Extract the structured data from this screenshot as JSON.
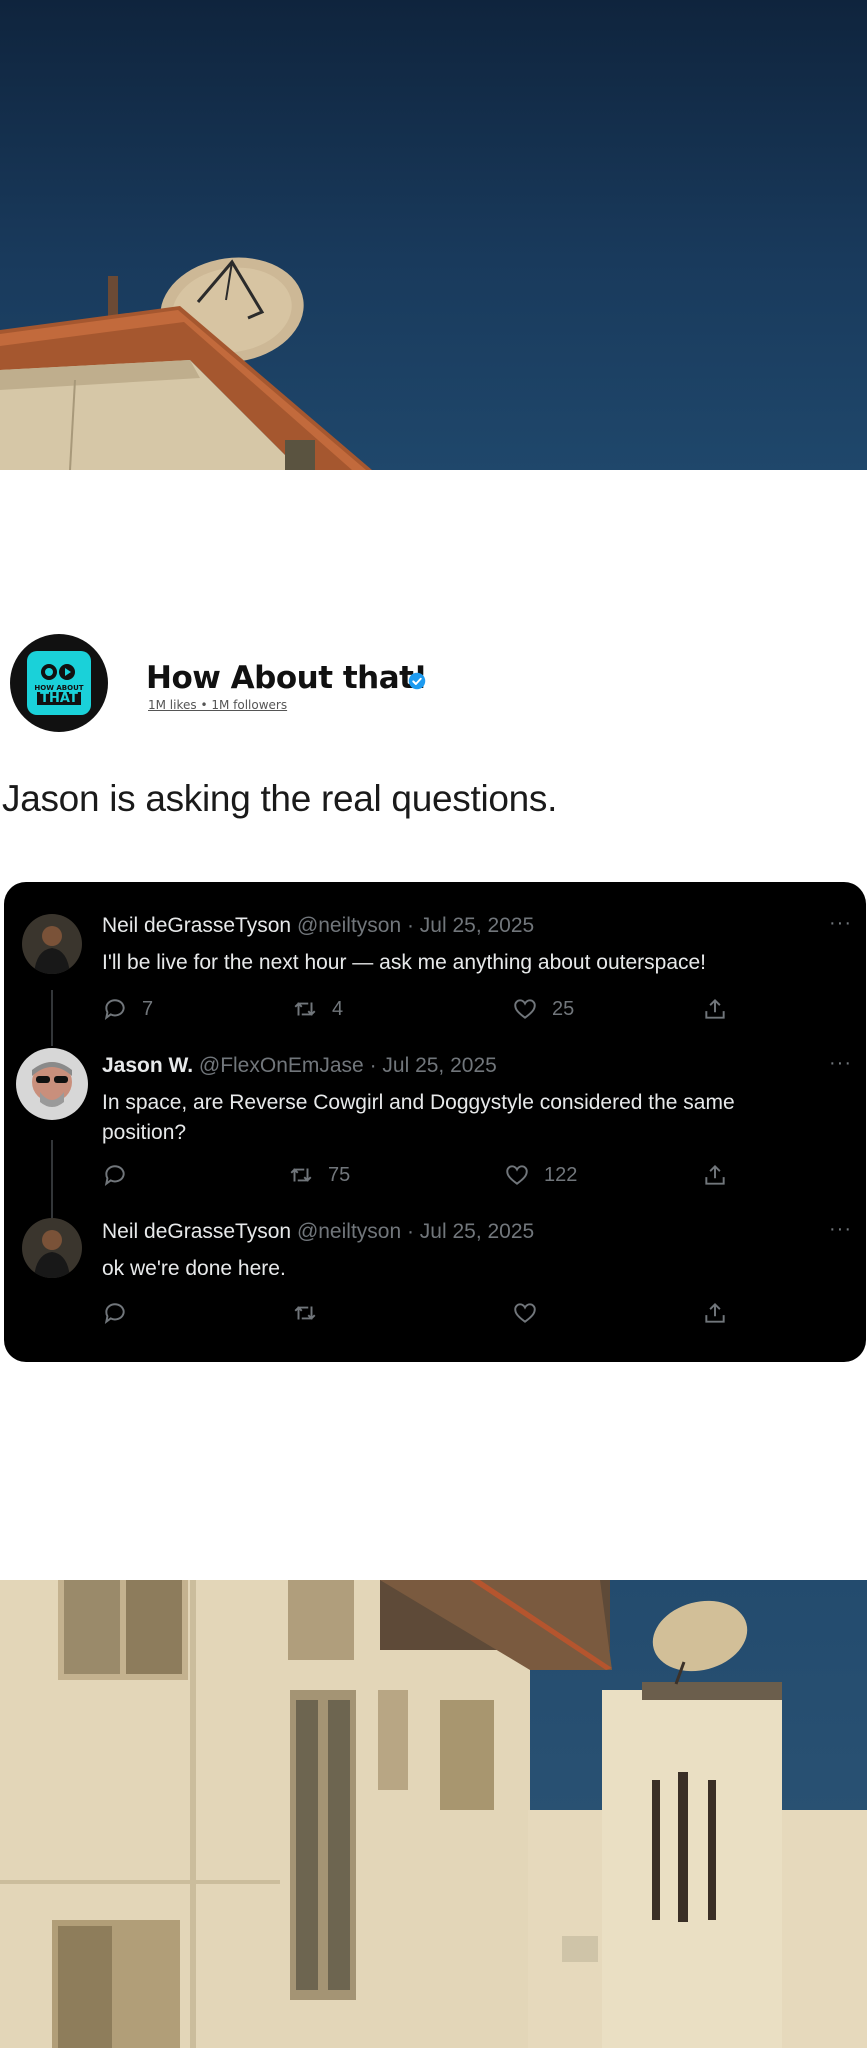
{
  "page": {
    "name": "How About that!",
    "stats": "1M likes • 1M followers",
    "avatar_text_top": "HOW ABOUT",
    "avatar_text_bottom": "THAT"
  },
  "post": {
    "caption": "Jason is asking the real questions."
  },
  "tweets": [
    {
      "name": "Neil deGrasseTyson",
      "meta": "@neiltyson · Jul 25, 2025",
      "text": "I'll be live for the next hour — ask me anything about outerspace!",
      "replies": "7",
      "retweets": "4",
      "likes": "25",
      "more": "···"
    },
    {
      "name": "Jason W.",
      "meta": "@FlexOnEmJase · Jul 25, 2025",
      "text_line1": "In space, are Reverse Cowgirl and Doggystyle considered the same",
      "text_line2": "position?",
      "replies": "",
      "retweets": "75",
      "likes": "122",
      "more": "···"
    },
    {
      "name": "Neil deGrasseTyson",
      "meta": "@neiltyson · Jul 25, 2025",
      "text": "ok we're done here.",
      "replies": "",
      "retweets": "",
      "likes": "",
      "more": "···"
    }
  ],
  "colors": {
    "card_bg": "#000000",
    "text_primary": "#e7e9ea",
    "text_secondary": "#71767b",
    "verified": "#1d9bf0",
    "brand_teal": "#1ad1d9"
  }
}
